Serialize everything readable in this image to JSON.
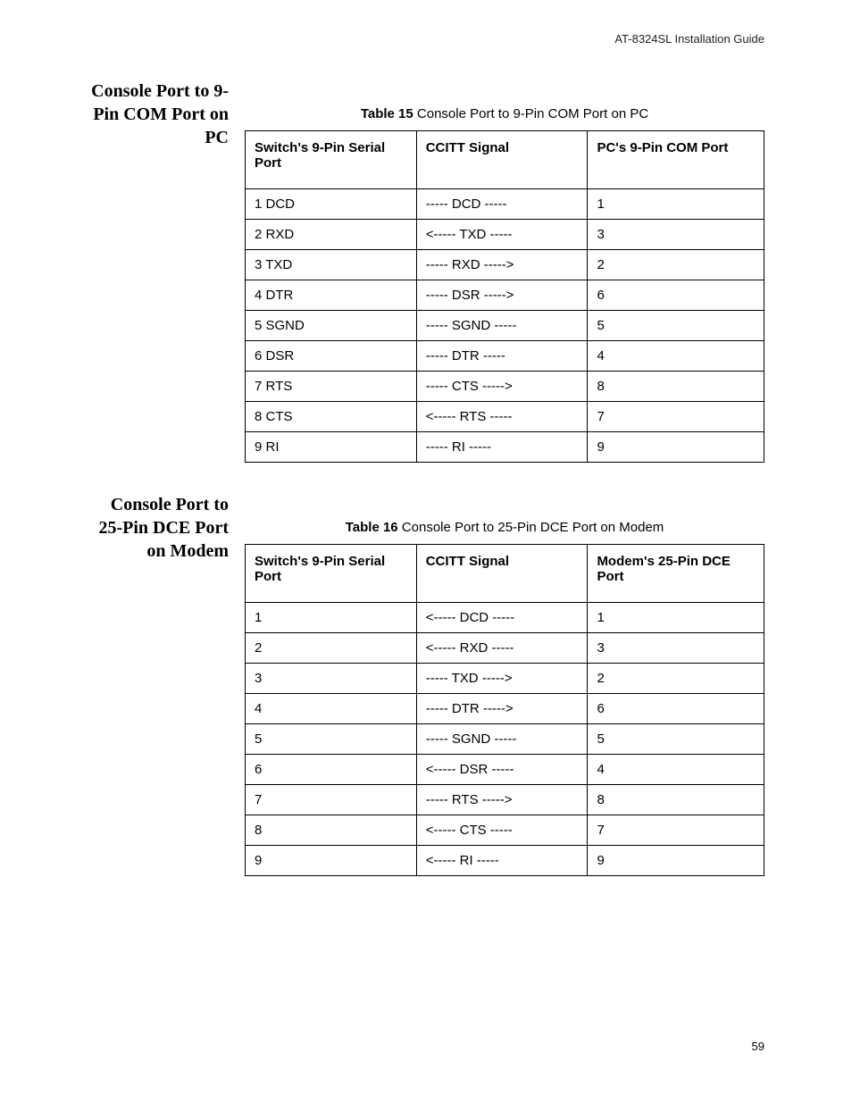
{
  "header": {
    "guide": "AT-8324SL Installation Guide"
  },
  "pageNumber": "59",
  "section1": {
    "heading": "Console Port to 9-Pin COM Port on PC",
    "caption_bold": "Table 15",
    "caption_rest": "  Console Port to 9-Pin COM Port on PC",
    "headers": {
      "c1": "Switch's 9-Pin Serial Port",
      "c2": "CCITT Signal",
      "c3": "PC's 9-Pin COM Port"
    },
    "rows": [
      {
        "c1": "1 DCD",
        "c2": "----- DCD -----",
        "c3": "1"
      },
      {
        "c1": "2 RXD",
        "c2": "<----- TXD -----",
        "c3": "3"
      },
      {
        "c1": "3 TXD",
        "c2": "----- RXD ----->",
        "c3": "2"
      },
      {
        "c1": "4 DTR",
        "c2": "----- DSR ----->",
        "c3": "6"
      },
      {
        "c1": "5 SGND",
        "c2": "----- SGND -----",
        "c3": "5"
      },
      {
        "c1": "6 DSR",
        "c2": "----- DTR -----",
        "c3": "4"
      },
      {
        "c1": "7 RTS",
        "c2": "----- CTS ----->",
        "c3": "8"
      },
      {
        "c1": "8 CTS",
        "c2": "<----- RTS -----",
        "c3": "7"
      },
      {
        "c1": "9 RI",
        "c2": "----- RI -----",
        "c3": "9"
      }
    ]
  },
  "section2": {
    "heading": "Console Port to 25-Pin DCE Port on Modem",
    "caption_bold": "Table 16",
    "caption_rest": "  Console Port to 25-Pin DCE Port on Modem",
    "headers": {
      "c1": "Switch's 9-Pin Serial Port",
      "c2": "CCITT Signal",
      "c3": "Modem's 25-Pin DCE Port"
    },
    "rows": [
      {
        "c1": "1",
        "c2": "<----- DCD -----",
        "c3": "1"
      },
      {
        "c1": "2",
        "c2": "<----- RXD -----",
        "c3": "3"
      },
      {
        "c1": "3",
        "c2": "----- TXD ----->",
        "c3": "2"
      },
      {
        "c1": "4",
        "c2": "----- DTR ----->",
        "c3": "6"
      },
      {
        "c1": "5",
        "c2": "----- SGND -----",
        "c3": "5"
      },
      {
        "c1": "6",
        "c2": "<----- DSR -----",
        "c3": "4"
      },
      {
        "c1": "7",
        "c2": "----- RTS ----->",
        "c3": "8"
      },
      {
        "c1": "8",
        "c2": "<----- CTS -----",
        "c3": "7"
      },
      {
        "c1": "9",
        "c2": "<----- RI -----",
        "c3": "9"
      }
    ]
  }
}
